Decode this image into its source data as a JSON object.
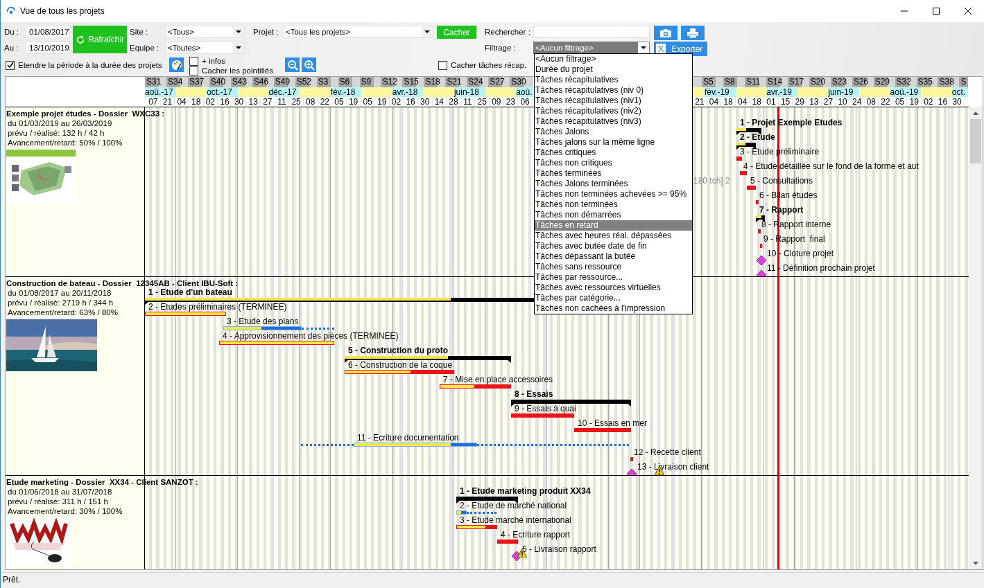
{
  "window": {
    "title": "Vue de tous les projets"
  },
  "toolbar": {
    "from_label": "Du :",
    "from": "01/08/2017",
    "to_label": "Au :",
    "to": "13/10/2019",
    "refresh": "Rafraîchir",
    "site_label": "Site :",
    "site": "<Tous>",
    "team_label": "Equipe :",
    "team": "<Toutes>",
    "project_label": "Projet :",
    "project": "<Tous les projets>",
    "hide": "Cacher",
    "search_label": "Rechercher :",
    "filter_label": "Filtrage :",
    "filter": "<Aucun filtrage>",
    "export": "Exporter",
    "export_icon": "X"
  },
  "options": [
    {
      "label": "Etendre la période à la durée des projets",
      "checked": true
    },
    {
      "label": "+ infos",
      "checked": false
    },
    {
      "label": "Cacher les pointillés",
      "checked": false
    },
    {
      "label": "Cacher tâches récap.",
      "checked": false
    }
  ],
  "filter_menu": [
    {
      "label": "<Aucun filtrage>",
      "selected": false
    },
    {
      "label": "Durée du projet",
      "selected": false
    },
    {
      "label": "Tâches récapitulatives",
      "selected": false
    },
    {
      "label": "Tâches récapitulatives (niv 0)",
      "selected": false
    },
    {
      "label": "Tâches récapitulatives (niv1)",
      "selected": false
    },
    {
      "label": "Tâches récapitulatives (niv2)",
      "selected": false
    },
    {
      "label": "Tâches récapitulatives (niv3)",
      "selected": false
    },
    {
      "label": "Tâches Jalons",
      "selected": false
    },
    {
      "label": "Tâches jalons sur la même ligne",
      "selected": false
    },
    {
      "label": "Tâches critiques",
      "selected": false
    },
    {
      "label": "Tâches non critiques",
      "selected": false
    },
    {
      "label": "Tâches terminées",
      "selected": false
    },
    {
      "label": "Tâches Jalons terminées",
      "selected": false
    },
    {
      "label": "Tâches non terminées achevées >= 95%",
      "selected": false
    },
    {
      "label": "Tâches non terminées",
      "selected": false
    },
    {
      "label": "Tâches non démarrées",
      "selected": false
    },
    {
      "label": "Tâches en retard",
      "selected": true
    },
    {
      "label": "Tâches avec heures réal. dépassées",
      "selected": false
    },
    {
      "label": "Tâches avec butée date de fin",
      "selected": false
    },
    {
      "label": "Tâches dépassant la butée",
      "selected": false
    },
    {
      "label": "Tâches sans ressource",
      "selected": false
    },
    {
      "label": "Tâches par ressource...",
      "selected": false
    },
    {
      "label": "Tâches avec ressources virtuelles",
      "selected": false
    },
    {
      "label": "Tâches par catégorie...",
      "selected": false
    },
    {
      "label": "Tâches non cachées à l'impression",
      "selected": false
    }
  ],
  "timeline": {
    "segments": [
      {
        "weeks": [
          "S31",
          "S34",
          "S37",
          "S40",
          "S43",
          "S46",
          "S49",
          "S52",
          "S3",
          "S6",
          "S9",
          "S12",
          "S15",
          "S18",
          "S21",
          "S24",
          "S27",
          "S30"
        ],
        "months": [
          "aoû.-17",
          "oct.-17",
          "déc.-17",
          "fév.-18",
          "avr.-18",
          "juin-18",
          "aoû."
        ],
        "days": [
          "07",
          "21",
          "04",
          "18",
          "02",
          "16",
          "30",
          "13",
          "27",
          "11",
          "25",
          "08",
          "22",
          "05",
          "19",
          "05",
          "19",
          "02",
          "16",
          "30",
          "14",
          "28",
          "11",
          "25",
          "09",
          "23",
          "06"
        ]
      },
      {
        "weeks": [
          "S5",
          "S8",
          "S11",
          "S14",
          "S17",
          "S20",
          "S23",
          "S26",
          "S29",
          "S32",
          "S35",
          "S38",
          "S"
        ],
        "months": [
          "fév.-19",
          "avr.-19",
          "juin-19",
          "aoû.-19",
          "oct."
        ],
        "days": [
          "21",
          "04",
          "18",
          "04",
          "18",
          "01",
          "15",
          "29",
          "13",
          "27",
          "10",
          "24",
          "08",
          "22",
          "05",
          "19",
          "02",
          "16",
          "30"
        ]
      }
    ]
  },
  "projects": [
    {
      "title": "Exemple projet études - Dossier  WXC33 :",
      "dates": "du 01/03/2019 au 26/03/2019",
      "hours": "prévu / réalisé: 132 h / 42 h",
      "progress": "Avancement/retard: 50% / 100%",
      "note": "180 tch] 2",
      "tasks": [
        {
          "label": "1 - Projet Exemple Etudes",
          "kind": "summary",
          "warning": false
        },
        {
          "label": "2 - Etude",
          "kind": "summary",
          "warning": false
        },
        {
          "label": "3 - Etude préliminaire",
          "kind": "late",
          "warning": false
        },
        {
          "label": "4 - Etude détaillée sur le fond de la forme et aut",
          "kind": "late",
          "warning": false
        },
        {
          "label": "5 - Consultations",
          "kind": "late",
          "warning": false
        },
        {
          "label": "6 - Bilan études",
          "kind": "late",
          "warning": false
        },
        {
          "label": "7 - Rapport",
          "kind": "summary",
          "warning": false
        },
        {
          "label": "8 - Rapport interne",
          "kind": "late",
          "warning": false
        },
        {
          "label": "9 - Rapport  final",
          "kind": "late",
          "warning": false
        },
        {
          "label": "10 - Cloture projet",
          "kind": "milestone",
          "warning": false
        },
        {
          "label": "11 - Définition prochain projet",
          "kind": "milestone",
          "warning": false
        }
      ]
    },
    {
      "title": "Construction de bateau - Dossier  12345AB - Client IBU-Soft :",
      "dates": "du 01/08/2017 au 20/11/2018",
      "hours": "prévu / réalisé: 2719 h / 344 h",
      "progress": "Avancement/retard: 63% / 80%",
      "tasks": [
        {
          "label": "1 - Etude d'un bateau",
          "kind": "summary",
          "warning": false
        },
        {
          "label": "2 - Etudes préliminaires (TERMINEE)",
          "kind": "done",
          "warning": false
        },
        {
          "label": "3 - Etude des plans",
          "kind": "ongoing",
          "warning": false
        },
        {
          "label": "4 - Approvisionnement des pièces (TERMINEE)",
          "kind": "done",
          "warning": false
        },
        {
          "label": "5 - Construction du proto",
          "kind": "summary",
          "warning": false
        },
        {
          "label": "6 - Construction de la coque",
          "kind": "overdue",
          "warning": false
        },
        {
          "label": "7 - Mise en place accessoires",
          "kind": "overdue",
          "warning": false
        },
        {
          "label": "8 - Essais",
          "kind": "summary",
          "warning": false
        },
        {
          "label": "9 - Essais à quai",
          "kind": "late",
          "warning": false
        },
        {
          "label": "10 - Essais en mer",
          "kind": "late",
          "warning": false
        },
        {
          "label": "11 - Ecriture documentation",
          "kind": "ongoing",
          "warning": false
        },
        {
          "label": "12 - Recette client",
          "kind": "late",
          "warning": false
        },
        {
          "label": "13 - Livraison client",
          "kind": "milestone",
          "warning": true
        }
      ]
    },
    {
      "title": "Etude marketing - Dossier  XX34 - Client SANZOT :",
      "dates": "du 01/06/2018 au 31/07/2018",
      "hours": "prévu / réalisé: 311 h / 151 h",
      "progress": "Avancement/retard: 30% / 100%",
      "tasks": [
        {
          "label": "1 - Etude marketing produit XX34",
          "kind": "summary",
          "warning": false
        },
        {
          "label": "2 - Etude de marché national",
          "kind": "ongoing",
          "warning": false
        },
        {
          "label": "3 - Etude marché international",
          "kind": "overdue",
          "warning": false
        },
        {
          "label": "4 - Ecriture rapport",
          "kind": "late",
          "warning": false
        },
        {
          "label": "5 - Livraison rapport",
          "kind": "milestone",
          "warning": true
        }
      ]
    }
  ],
  "status_bar": "Prêt."
}
